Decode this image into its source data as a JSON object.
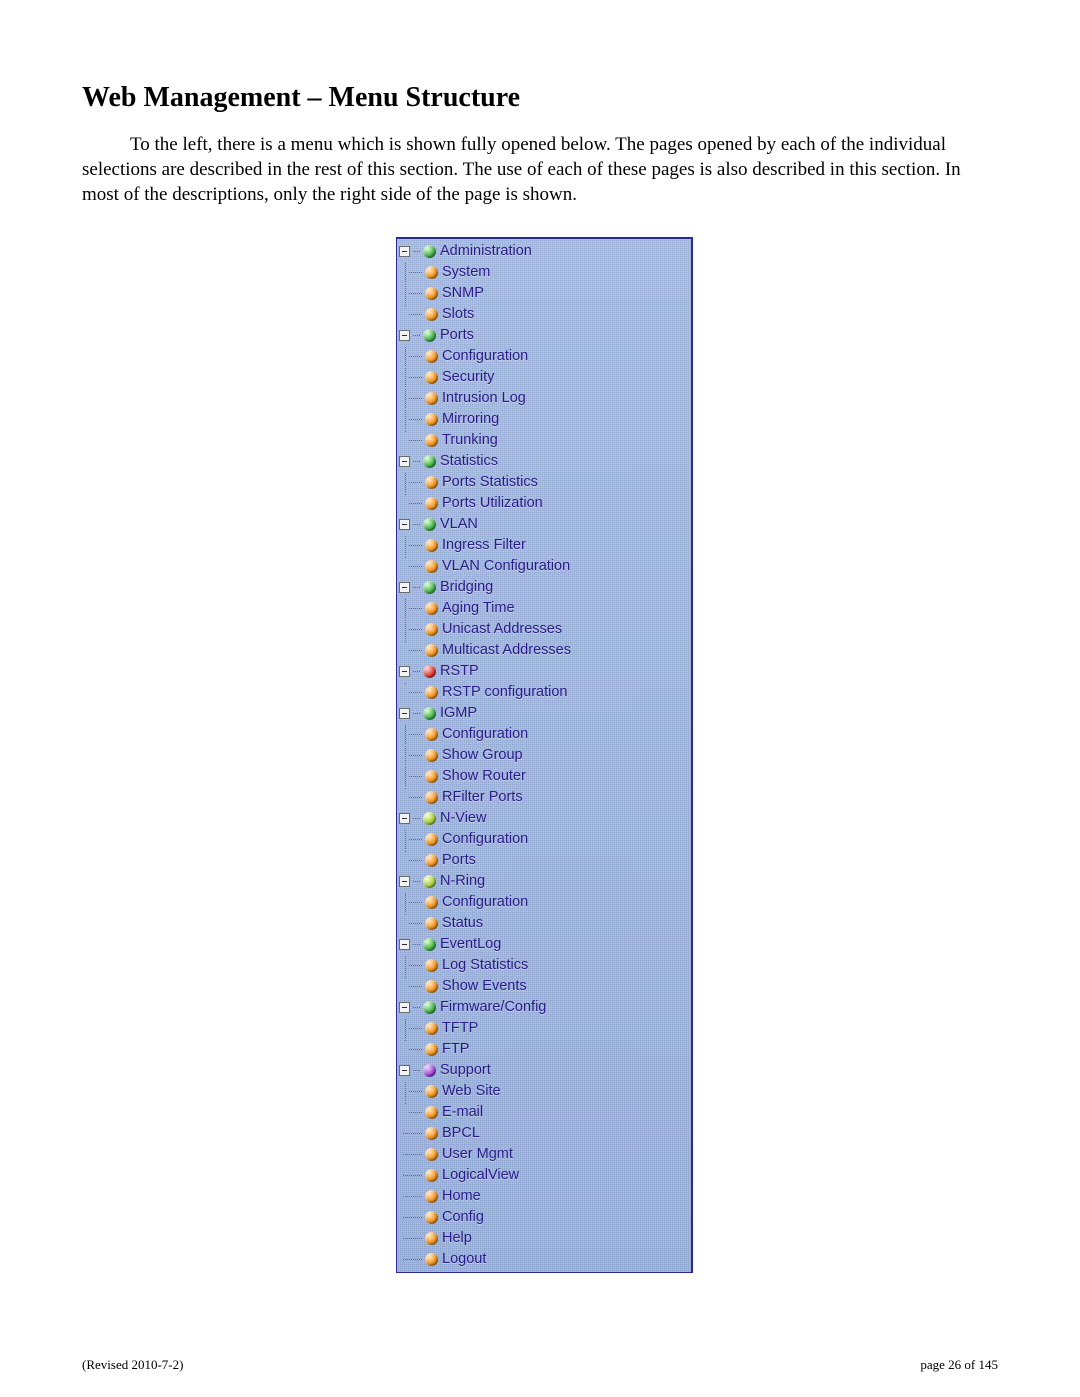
{
  "heading": "Web Management – Menu Structure",
  "paragraph": "To the left, there is a menu which is shown fully opened below.  The pages opened by each of the individual selections are described in the rest of this section.  The use of each of these pages is also described in this section.  In most of the descriptions, only the right side of the page is shown.",
  "footer_left": "(Revised 2010-7-2)",
  "footer_right": "page 26 of 145",
  "menu": [
    {
      "label": "Administration",
      "color": "green",
      "children": [
        {
          "label": "System",
          "color": "orange"
        },
        {
          "label": "SNMP",
          "color": "orange"
        },
        {
          "label": "Slots",
          "color": "orange"
        }
      ]
    },
    {
      "label": "Ports",
      "color": "green",
      "children": [
        {
          "label": "Configuration",
          "color": "orange"
        },
        {
          "label": "Security",
          "color": "orange"
        },
        {
          "label": "Intrusion Log",
          "color": "orange"
        },
        {
          "label": "Mirroring",
          "color": "orange"
        },
        {
          "label": "Trunking",
          "color": "orange"
        }
      ]
    },
    {
      "label": "Statistics",
      "color": "green",
      "children": [
        {
          "label": "Ports Statistics",
          "color": "orange"
        },
        {
          "label": "Ports Utilization",
          "color": "orange"
        }
      ]
    },
    {
      "label": "VLAN",
      "color": "green",
      "children": [
        {
          "label": "Ingress Filter",
          "color": "orange"
        },
        {
          "label": "VLAN Configuration",
          "color": "orange"
        }
      ]
    },
    {
      "label": "Bridging",
      "color": "green",
      "children": [
        {
          "label": "Aging Time",
          "color": "orange"
        },
        {
          "label": "Unicast Addresses",
          "color": "orange"
        },
        {
          "label": "Multicast Addresses",
          "color": "orange"
        }
      ]
    },
    {
      "label": "RSTP",
      "color": "red",
      "children": [
        {
          "label": "RSTP configuration",
          "color": "orange"
        }
      ]
    },
    {
      "label": "IGMP",
      "color": "green",
      "children": [
        {
          "label": "Configuration",
          "color": "orange"
        },
        {
          "label": "Show Group",
          "color": "orange"
        },
        {
          "label": "Show Router",
          "color": "orange"
        },
        {
          "label": "RFilter Ports",
          "color": "orange"
        }
      ]
    },
    {
      "label": "N-View",
      "color": "lime",
      "children": [
        {
          "label": "Configuration",
          "color": "orange"
        },
        {
          "label": "Ports",
          "color": "orange"
        }
      ]
    },
    {
      "label": "N-Ring",
      "color": "lime",
      "children": [
        {
          "label": "Configuration",
          "color": "orange"
        },
        {
          "label": "Status",
          "color": "orange"
        }
      ]
    },
    {
      "label": "EventLog",
      "color": "green",
      "children": [
        {
          "label": "Log Statistics",
          "color": "orange"
        },
        {
          "label": "Show Events",
          "color": "orange"
        }
      ]
    },
    {
      "label": "Firmware/Config",
      "color": "green",
      "children": [
        {
          "label": "TFTP",
          "color": "orange"
        },
        {
          "label": "FTP",
          "color": "orange"
        }
      ]
    },
    {
      "label": "Support",
      "color": "purple",
      "children": [
        {
          "label": "Web Site",
          "color": "orange"
        },
        {
          "label": "E-mail",
          "color": "orange"
        }
      ]
    },
    {
      "label": "BPCL",
      "color": "orange"
    },
    {
      "label": "User Mgmt",
      "color": "orange"
    },
    {
      "label": "LogicalView",
      "color": "orange"
    },
    {
      "label": "Home",
      "color": "orange"
    },
    {
      "label": "Config",
      "color": "orange"
    },
    {
      "label": "Help",
      "color": "orange"
    },
    {
      "label": "Logout",
      "color": "orange"
    }
  ]
}
